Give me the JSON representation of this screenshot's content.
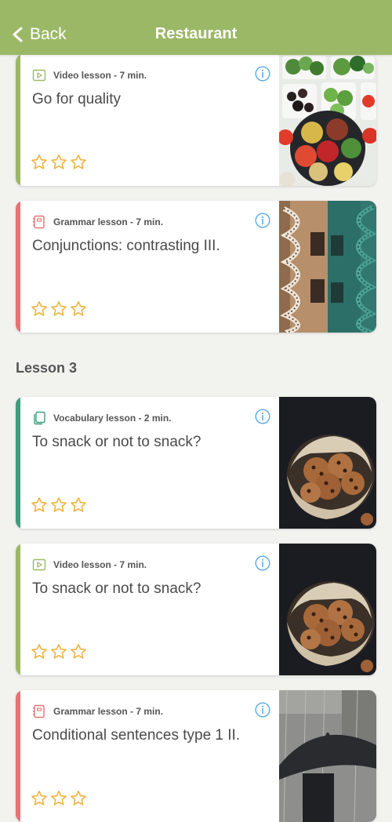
{
  "header": {
    "back_label": "Back",
    "title": "Restaurant"
  },
  "section": {
    "title": "Lesson 3"
  },
  "cards": [
    {
      "type_label": "Video lesson - 7 min.",
      "title": "Go for quality",
      "kind": "video",
      "accent": "#9bb867",
      "icon": "play-icon",
      "image": "vegetables-bowls",
      "stars_filled": 0,
      "stars_total": 3
    },
    {
      "type_label": "Grammar lesson - 7 min.",
      "title": "Conjunctions: contrasting III.",
      "kind": "grammar",
      "accent": "#e57373",
      "icon": "notebook-icon",
      "image": "spiral-staircases",
      "stars_filled": 0,
      "stars_total": 3
    },
    {
      "type_label": "Vocabulary lesson - 2 min.",
      "title": "To snack or not to snack?",
      "kind": "vocabulary",
      "accent": "#3f9c7d",
      "icon": "cards-icon",
      "image": "cookies-bowl",
      "stars_filled": 0,
      "stars_total": 3
    },
    {
      "type_label": "Video lesson - 7 min.",
      "title": "To snack or not to snack?",
      "kind": "video",
      "accent": "#9bb867",
      "icon": "play-icon",
      "image": "cookies-bowl",
      "stars_filled": 0,
      "stars_total": 3
    },
    {
      "type_label": "Grammar lesson - 7 min.",
      "title": "Conditional sentences type 1 II.",
      "kind": "grammar",
      "accent": "#e57373",
      "icon": "notebook-icon",
      "image": "umbrella-rain",
      "stars_filled": 0,
      "stars_total": 3
    }
  ],
  "colors": {
    "header": "#9bb867",
    "star": "#f2b33d",
    "info": "#5aa9e6"
  }
}
